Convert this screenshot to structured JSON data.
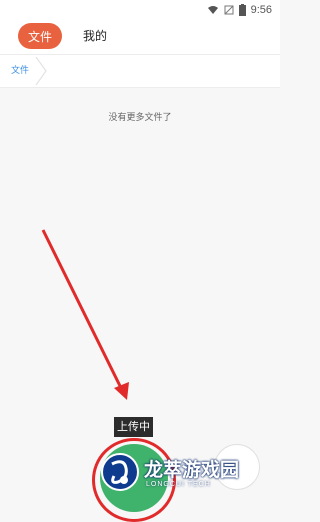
{
  "status_bar": {
    "time": "9:56"
  },
  "tabs": {
    "files": "文件",
    "mine": "我的"
  },
  "breadcrumb": {
    "root": "文件"
  },
  "content": {
    "empty_message": "没有更多文件了"
  },
  "upload": {
    "tooltip": "上传中"
  },
  "watermark": {
    "title": "龙萃游戏园",
    "subtitle": "LONGCUI TECH"
  },
  "colors": {
    "accent": "#e8623f",
    "link": "#3b8fe0",
    "annotation": "#e12b2b",
    "fab": "#3fb36b"
  }
}
